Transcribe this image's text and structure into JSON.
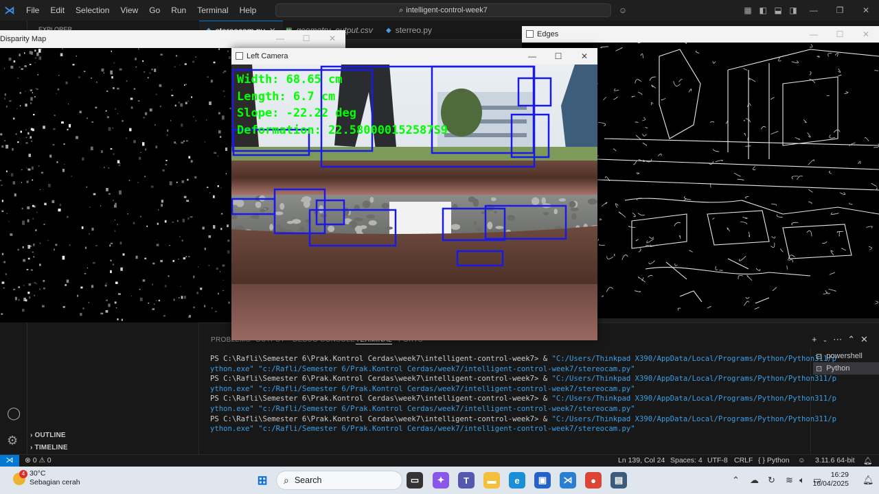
{
  "titlebar": {
    "menu": [
      "File",
      "Edit",
      "Selection",
      "View",
      "Go",
      "Run",
      "Terminal",
      "Help"
    ],
    "search_text": "intelligent-control-week7"
  },
  "sidebar": {
    "explorer_label": "EXPLORER",
    "outline_label": "OUTLINE",
    "timeline_label": "TIMELINE"
  },
  "tabs": [
    {
      "label": "stereocam.py",
      "icon": "python-file-icon",
      "active": true
    },
    {
      "label": "geometry_output.csv",
      "icon": "csv-file-icon",
      "active": false
    },
    {
      "label": "sterreo.py",
      "icon": "python-file-icon",
      "active": false
    }
  ],
  "windows": {
    "disparity_title": "Disparity Map",
    "left_camera_title": "Left Camera",
    "edges_title": "Edges"
  },
  "camera_overlay": {
    "width": "Width: 68.65 cm",
    "length": "Length: 6.7 cm",
    "slope": "Slope: -22.22 deg",
    "deformation": "Deformation: 22.580000152587S9",
    "text_color": "#00ff00",
    "box_color": "#1a1ae6"
  },
  "panel": {
    "tabs": [
      "PROBLEMS",
      "OUTPUT",
      "DEBUG CONSOLE",
      "TERMINAL",
      "PORTS"
    ],
    "active_tab": "TERMINAL",
    "terminal_lines": [
      {
        "prompt": "PS C:\\Rafli\\Semester 6\\Prak.Kontrol Cerdas\\week7\\intelligent-control-week7> & ",
        "cmd": "\"C:/Users/Thinkpad X390/AppData/Local/Programs/Python/Python311/p",
        "cont": "ython.exe\" \"c:/Rafli/Semester 6/Prak.Kontrol Cerdas/week7/intelligent-control-week7/stereocam.py\""
      },
      {
        "prompt": "PS C:\\Rafli\\Semester 6\\Prak.Kontrol Cerdas\\week7\\intelligent-control-week7> & ",
        "cmd": "\"C:/Users/Thinkpad X390/AppData/Local/Programs/Python/Python311/p",
        "cont": "ython.exe\" \"c:/Rafli/Semester 6/Prak.Kontrol Cerdas/week7/intelligent-control-week7/stereocam.py\""
      },
      {
        "prompt": "PS C:\\Rafli\\Semester 6\\Prak.Kontrol Cerdas\\week7\\intelligent-control-week7> & ",
        "cmd": "\"C:/Users/Thinkpad X390/AppData/Local/Programs/Python/Python311/p",
        "cont": "ython.exe\" \"c:/Rafli/Semester 6/Prak.Kontrol Cerdas/week7/intelligent-control-week7/stereocam.py\""
      },
      {
        "prompt": "PS C:\\Rafli\\Semester 6\\Prak.Kontrol Cerdas\\week7\\intelligent-control-week7> & ",
        "cmd": "\"C:/Users/Thinkpad X390/AppData/Local/Programs/Python/Python311/p",
        "cont": "ython.exe\" \"c:/Rafli/Semester 6/Prak.Kontrol Cerdas/week7/intelligent-control-week7/stereocam.py\""
      }
    ],
    "terminal_list": [
      "powershell",
      "Python"
    ],
    "selected_terminal": "Python"
  },
  "statusbar": {
    "problems": "⊗ 0 ⚠ 0",
    "cursor": "Ln 139, Col 24",
    "spaces": "Spaces: 4",
    "encoding": "UTF-8",
    "eol": "CRLF",
    "language": "{ } Python",
    "interpreter": "3.11.6 64-bit",
    "accent": "#0078d4"
  },
  "taskbar": {
    "weather_temp": "30°C",
    "weather_desc": "Sebagian cerah",
    "weather_badge": "4",
    "search_label": "Search",
    "time": "16:29",
    "date": "16/04/2025"
  }
}
